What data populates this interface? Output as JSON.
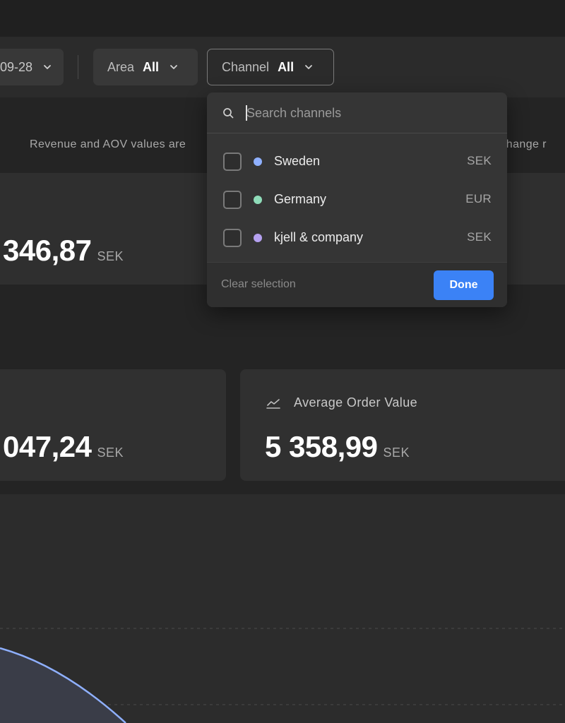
{
  "filters": {
    "date": {
      "value": "09-28"
    },
    "area": {
      "label": "Area",
      "value": "All"
    },
    "channel": {
      "label": "Channel",
      "value": "All"
    }
  },
  "notice": {
    "text_left": "Revenue and AOV values are",
    "text_right": "xchange r"
  },
  "cards": {
    "revenue": {
      "value": "346,87",
      "unit": "SEK"
    },
    "metric_left": {
      "value": "047,24",
      "unit": "SEK"
    },
    "aov": {
      "title": "Average Order Value",
      "icon": "trend-chart-icon",
      "value": "5 358,99",
      "unit": "SEK"
    }
  },
  "channel_dropdown": {
    "search_placeholder": "Search channels",
    "options": [
      {
        "name": "Sweden",
        "currency": "SEK",
        "color": "#8fb0ff",
        "checked": false
      },
      {
        "name": "Germany",
        "currency": "EUR",
        "color": "#8fdcb9",
        "checked": false
      },
      {
        "name": "kjell & company",
        "currency": "SEK",
        "color": "#b5a1f0",
        "checked": false
      }
    ],
    "clear_label": "Clear selection",
    "done_label": "Done"
  },
  "colors": {
    "accent": "#3b82f6",
    "chart_line": "#8fb0ff"
  }
}
